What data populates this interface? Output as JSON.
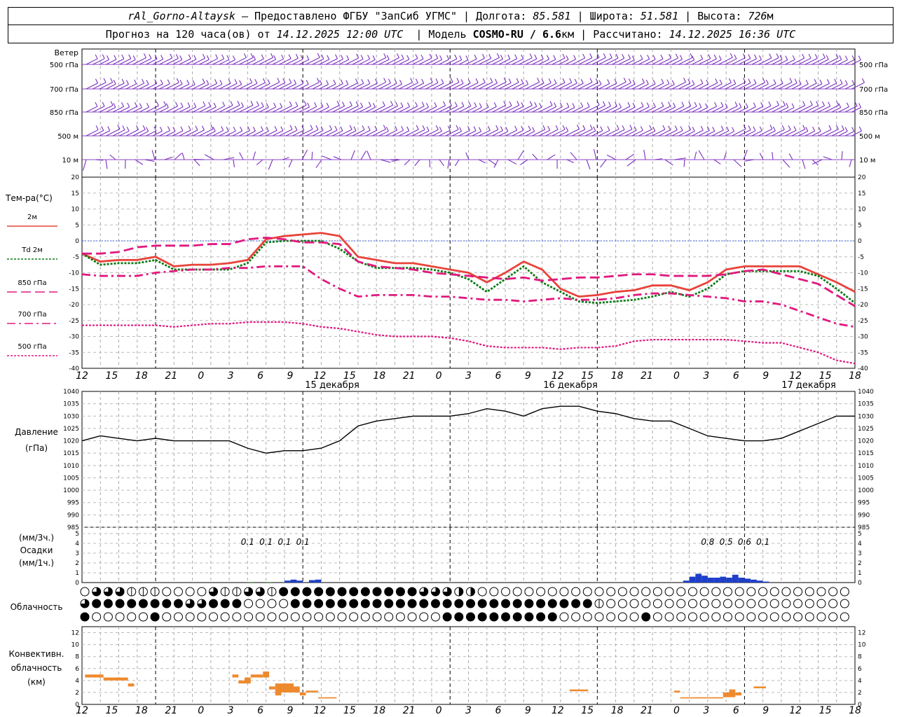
{
  "header": {
    "station": "rAl_Gorno-Altaysk",
    "provider": "— Предоставлено ФГБУ \"ЗапСиб УГМС\"",
    "lon_label": "Долгота:",
    "lon": "85.581",
    "lat_label": "Широта:",
    "lat": "51.581",
    "alt_label": "Высота:",
    "alt": "726",
    "alt_unit": "м",
    "forecast_label": "Прогноз на 120 часа(ов) от",
    "forecast_start": "14.12.2025 12:00 UTC",
    "model_label": "Модель",
    "model": "COSMO-RU / 6.6",
    "model_unit": "км",
    "calc_label": "Рассчитано:",
    "calc_time": "14.12.2025 16:36 UTC"
  },
  "time_axis": {
    "hour_labels": [
      "12",
      "15",
      "18",
      "21",
      "0",
      "3",
      "6",
      "9",
      "12",
      "15",
      "18",
      "21",
      "0",
      "3",
      "6",
      "9",
      "12",
      "15",
      "18",
      "21",
      "0",
      "3",
      "6",
      "9",
      "12",
      "15",
      "18"
    ],
    "day_labels": [
      "15 декабря",
      "16 декабря",
      "17 декабря"
    ]
  },
  "chart_data": [
    {
      "type": "wind_barbs",
      "title": "Ветер",
      "levels": [
        "500 гПа",
        "700 гПа",
        "850 гПа",
        "500 м",
        "10 м"
      ],
      "color": "#7b2fbe"
    },
    {
      "type": "line",
      "title": "Тем-ра(°C)",
      "ylim": [
        -40,
        20
      ],
      "yticks": [
        20,
        15,
        10,
        5,
        0,
        -5,
        -10,
        -15,
        -20,
        -25,
        -30,
        -35,
        -40
      ],
      "x_hours": [
        0,
        3,
        6,
        9,
        12,
        15,
        18,
        21,
        24,
        27,
        30,
        33,
        36,
        39,
        42,
        45,
        48,
        51,
        54,
        57,
        60,
        63,
        66,
        69,
        72,
        75,
        78,
        81,
        84,
        87,
        90,
        93,
        96,
        99,
        102,
        105,
        108,
        111,
        114,
        117,
        120,
        123,
        126
      ],
      "series": [
        {
          "name": "2м",
          "color": "#e8433a",
          "style": "solid",
          "values": [
            -4,
            -6.5,
            -6,
            -6,
            -5,
            -8,
            -7.5,
            -7.5,
            -7,
            -6,
            0.5,
            1.5,
            2,
            2.5,
            1.5,
            -5,
            -6,
            -7,
            -7,
            -8,
            -9,
            -10,
            -13,
            -10,
            -6.5,
            -9,
            -15,
            -17.5,
            -17,
            -16,
            -15.5,
            -14,
            -14,
            -15.5,
            -13,
            -9,
            -8,
            -8,
            -8,
            -8,
            -10.5,
            -13,
            -16
          ]
        },
        {
          "name": "Td 2м",
          "color": "#0a7a14",
          "style": "dotted",
          "values": [
            -4,
            -7.5,
            -7,
            -7,
            -6,
            -9,
            -9,
            -9,
            -9,
            -7,
            -0.5,
            0,
            0,
            0,
            -2.5,
            -6.5,
            -8.5,
            -8.5,
            -8.5,
            -9,
            -10,
            -12,
            -16,
            -12,
            -8,
            -13,
            -16,
            -19,
            -19.5,
            -19,
            -18.5,
            -17.5,
            -16,
            -17.5,
            -15,
            -10.5,
            -9.5,
            -9.5,
            -9.5,
            -9.5,
            -11,
            -15,
            -19.5
          ]
        },
        {
          "name": "850 гПа",
          "color": "#e0197f",
          "style": "longdash",
          "values": [
            -4,
            -4,
            -3.5,
            -2,
            -1.5,
            -1.5,
            -1.5,
            -1,
            -1,
            0.5,
            1,
            0.5,
            -0.5,
            -0.5,
            -1,
            -6.5,
            -8,
            -8.5,
            -9,
            -10,
            -10.5,
            -11,
            -11.5,
            -12,
            -11.5,
            -12.5,
            -12,
            -11.5,
            -11.5,
            -11,
            -10.5,
            -10.5,
            -11,
            -11,
            -11,
            -10.5,
            -9.5,
            -9,
            -10.5,
            -12,
            -13.5,
            -17,
            -20.5
          ]
        },
        {
          "name": "700 гПа",
          "color": "#e0197f",
          "style": "dashdot",
          "values": [
            -10.5,
            -11,
            -11,
            -11,
            -10,
            -9.5,
            -9,
            -9,
            -8.5,
            -8.5,
            -8,
            -8,
            -8,
            -12,
            -15,
            -17.5,
            -17,
            -17,
            -17,
            -17.5,
            -17.5,
            -18,
            -18.5,
            -18.5,
            -19,
            -18.5,
            -18,
            -18.5,
            -18.5,
            -18,
            -17,
            -16.5,
            -16.5,
            -17,
            -17.5,
            -18,
            -19,
            -19,
            -20,
            -22,
            -24,
            -26,
            -27
          ]
        },
        {
          "name": "500 гПа",
          "color": "#e0197f",
          "style": "dotted",
          "values": [
            -26.5,
            -26.5,
            -26.5,
            -26.5,
            -26.5,
            -27,
            -26.5,
            -26,
            -26,
            -25.5,
            -25.5,
            -25.5,
            -26,
            -27,
            -27.5,
            -28.5,
            -29.5,
            -30,
            -30,
            -30,
            -30.5,
            -31.5,
            -33,
            -33.5,
            -33.5,
            -33.5,
            -34,
            -33.5,
            -33.5,
            -33,
            -31.5,
            -31,
            -31,
            -31,
            -31,
            -31,
            -31.5,
            -32,
            -32,
            -33.5,
            -35,
            -37.5,
            -38.5
          ]
        }
      ]
    },
    {
      "type": "line",
      "title": "Давление",
      "ylabel": "(гПа)",
      "ylim": [
        985,
        1040
      ],
      "yticks": [
        1040,
        1035,
        1030,
        1025,
        1020,
        1015,
        1010,
        1005,
        1000,
        995,
        990,
        985
      ],
      "x_hours": [
        0,
        3,
        6,
        9,
        12,
        15,
        18,
        21,
        24,
        27,
        30,
        33,
        36,
        39,
        42,
        45,
        48,
        51,
        54,
        57,
        60,
        63,
        66,
        69,
        72,
        75,
        78,
        81,
        84,
        87,
        90,
        93,
        96,
        99,
        102,
        105,
        108,
        111,
        114,
        117,
        120,
        123,
        126
      ],
      "series": [
        {
          "color": "#000000",
          "values": [
            1020,
            1022,
            1021,
            1020,
            1021,
            1020,
            1020,
            1020,
            1020,
            1017,
            1015,
            1016,
            1016,
            1017,
            1020,
            1026,
            1028,
            1029,
            1030,
            1030,
            1030,
            1031,
            1033,
            1032,
            1030,
            1033,
            1034,
            1034,
            1032,
            1031,
            1029,
            1028,
            1028,
            1025,
            1022,
            1021,
            1020,
            1020,
            1021,
            1024,
            1027,
            1030,
            1030
          ]
        }
      ]
    },
    {
      "type": "bar",
      "title": "Осадки",
      "ylabel_top": "(мм/3ч.)",
      "ylabel_bottom": "(мм/1ч.)",
      "ylim": [
        0,
        5
      ],
      "yticks": [
        5,
        4,
        3,
        2,
        1,
        0
      ],
      "sum_labels": [
        {
          "hour": 27,
          "text": "0.1"
        },
        {
          "hour": 30,
          "text": "0.1"
        },
        {
          "hour": 33,
          "text": "0.1"
        },
        {
          "hour": 36,
          "text": "0.1"
        },
        {
          "hour": 102,
          "text": "0.8"
        },
        {
          "hour": 105,
          "text": "0.5"
        },
        {
          "hour": 108,
          "text": "0.6"
        },
        {
          "hour": 111,
          "text": "0.1"
        }
      ],
      "bars": [
        {
          "hour": 28,
          "value": 0.05,
          "color": "#2d8a2d"
        },
        {
          "hour": 31,
          "value": 0.05,
          "color": "#2d8a2d"
        },
        {
          "hour": 34,
          "value": 0.2,
          "color": "#1e3fc8"
        },
        {
          "hour": 35,
          "value": 0.3,
          "color": "#1e3fc8"
        },
        {
          "hour": 36,
          "value": 0.2,
          "color": "#1e3fc8"
        },
        {
          "hour": 38,
          "value": 0.25,
          "color": "#1e3fc8"
        },
        {
          "hour": 39,
          "value": 0.3,
          "color": "#1e3fc8"
        },
        {
          "hour": 99,
          "value": 0.2,
          "color": "#1e3fc8"
        },
        {
          "hour": 100,
          "value": 0.6,
          "color": "#1e3fc8"
        },
        {
          "hour": 101,
          "value": 0.9,
          "color": "#1e3fc8"
        },
        {
          "hour": 102,
          "value": 0.7,
          "color": "#1e3fc8"
        },
        {
          "hour": 103,
          "value": 0.5,
          "color": "#1e3fc8"
        },
        {
          "hour": 104,
          "value": 0.5,
          "color": "#1e3fc8"
        },
        {
          "hour": 105,
          "value": 0.6,
          "color": "#1e3fc8"
        },
        {
          "hour": 106,
          "value": 0.5,
          "color": "#1e3fc8"
        },
        {
          "hour": 107,
          "value": 0.8,
          "color": "#1e3fc8"
        },
        {
          "hour": 108,
          "value": 0.5,
          "color": "#1e3fc8"
        },
        {
          "hour": 109,
          "value": 0.4,
          "color": "#1e3fc8"
        },
        {
          "hour": 110,
          "value": 0.3,
          "color": "#1e3fc8"
        },
        {
          "hour": 111,
          "value": 0.2,
          "color": "#1e3fc8"
        },
        {
          "hour": 112,
          "value": 0.1,
          "color": "#1e3fc8"
        }
      ]
    },
    {
      "type": "cloud_symbols",
      "title": "Облачность",
      "rows": [
        "0333111000031133144444444444433322000000000000000000000000000000000400004413444444444444444444440000000000",
        "3444444443344400004444444444444444444444444410000000000000000000000000003144444444444444444444444444444444",
        "4000004000000000000000000000000444444444400000004000000000000000000000000000000000000000000444444444444443"
      ]
    },
    {
      "type": "bar",
      "title": "Конвективн. облачность (км)",
      "ylim": [
        0,
        13
      ],
      "yticks": [
        12,
        10,
        8,
        6,
        4,
        2,
        0
      ],
      "color": "#ee8a2e",
      "segments": [
        {
          "h0": 0.5,
          "h1": 3.5,
          "bottom": 4.5,
          "top": 5
        },
        {
          "h0": 3.5,
          "h1": 7.5,
          "bottom": 4,
          "top": 4.5
        },
        {
          "h0": 7.5,
          "h1": 8.5,
          "bottom": 3,
          "top": 3.5
        },
        {
          "h0": 24.5,
          "h1": 25.5,
          "bottom": 4.5,
          "top": 5
        },
        {
          "h0": 25.5,
          "h1": 26.5,
          "bottom": 3.5,
          "top": 4
        },
        {
          "h0": 26.5,
          "h1": 27.5,
          "bottom": 3.5,
          "top": 4.5
        },
        {
          "h0": 27.5,
          "h1": 29.5,
          "bottom": 4.5,
          "top": 5
        },
        {
          "h0": 29.5,
          "h1": 30.5,
          "bottom": 4.5,
          "top": 5.5
        },
        {
          "h0": 30.5,
          "h1": 31.5,
          "bottom": 2.5,
          "top": 3
        },
        {
          "h0": 31.5,
          "h1": 32.5,
          "bottom": 1.5,
          "top": 3.5
        },
        {
          "h0": 32.5,
          "h1": 34.5,
          "bottom": 2,
          "top": 3.5
        },
        {
          "h0": 34.5,
          "h1": 35.5,
          "bottom": 2,
          "top": 3
        },
        {
          "h0": 35.5,
          "h1": 36.5,
          "bottom": 1.5,
          "top": 2
        },
        {
          "h0": 36.5,
          "h1": 38.5,
          "bottom": 2,
          "top": 2.3
        },
        {
          "h0": 38.5,
          "h1": 41.5,
          "bottom": 1,
          "top": 1.2
        },
        {
          "h0": 79.5,
          "h1": 82.5,
          "bottom": 2.2,
          "top": 2.5
        },
        {
          "h0": 96.5,
          "h1": 97.5,
          "bottom": 2,
          "top": 2.3
        },
        {
          "h0": 97.5,
          "h1": 101.5,
          "bottom": 1,
          "top": 1.2
        },
        {
          "h0": 101.5,
          "h1": 104.5,
          "bottom": 1,
          "top": 1.2
        },
        {
          "h0": 104.5,
          "h1": 105.5,
          "bottom": 1.2,
          "top": 2
        },
        {
          "h0": 105.5,
          "h1": 106.5,
          "bottom": 1.2,
          "top": 2.5
        },
        {
          "h0": 106.5,
          "h1": 107.5,
          "bottom": 1.5,
          "top": 2
        },
        {
          "h0": 109.5,
          "h1": 111.5,
          "bottom": 2.7,
          "top": 3
        }
      ]
    }
  ]
}
